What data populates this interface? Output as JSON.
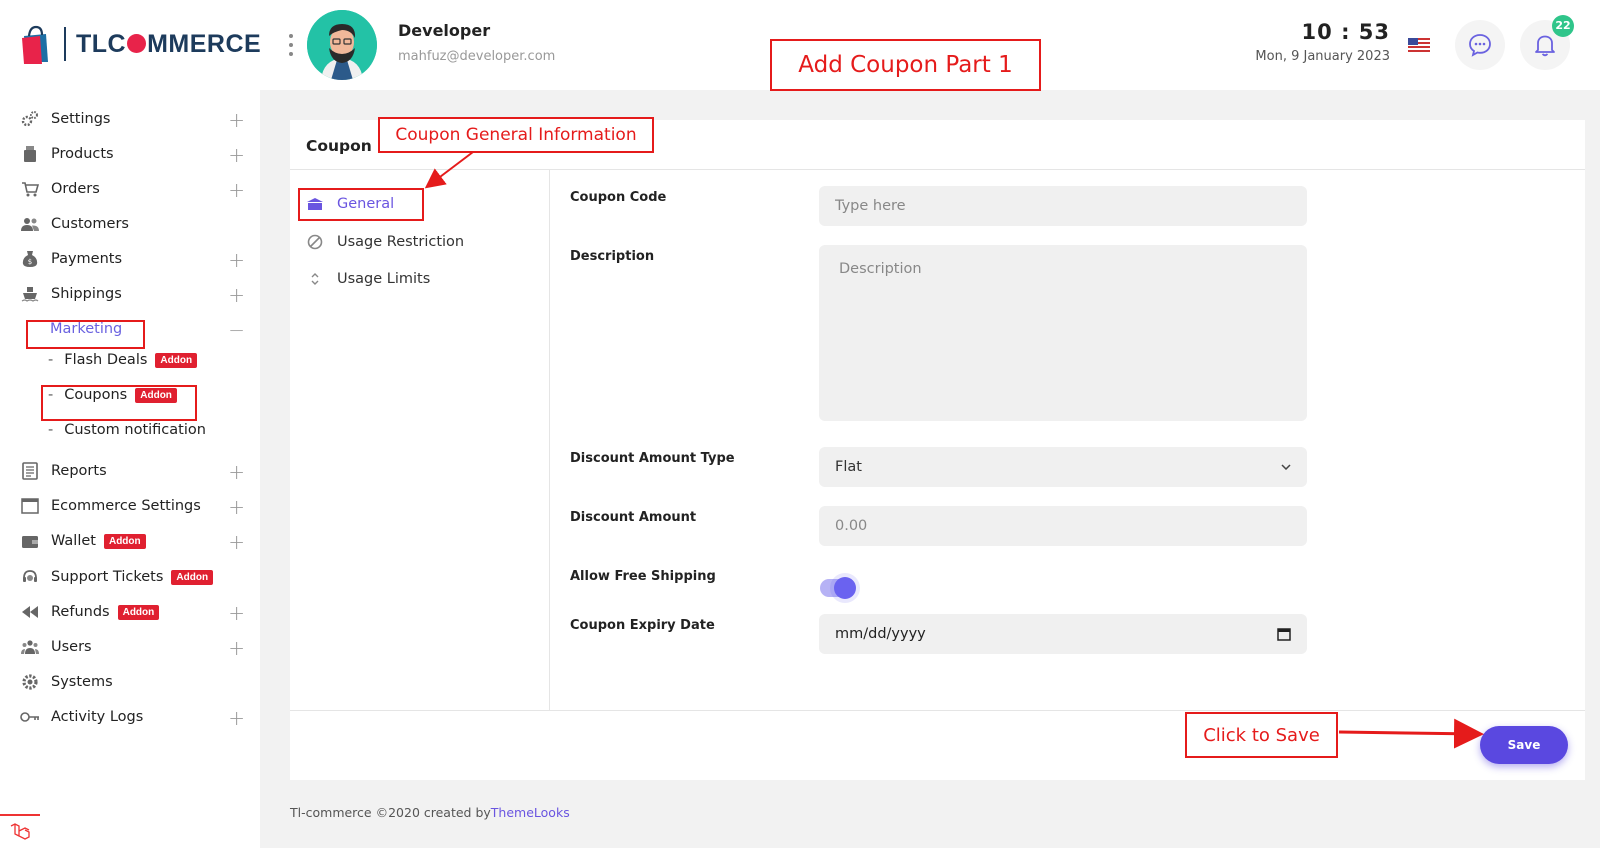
{
  "header": {
    "brand": "TLCOMMERCE",
    "brand_prefix": "TLC",
    "brand_suffix": "MMERCE",
    "user_name": "Developer",
    "user_email": "mahfuz@developer.com",
    "time": "10 : 53",
    "date": "Mon, 9 January 2023",
    "language_flag": "us-flag-icon",
    "notification_count": "22"
  },
  "sidebar": {
    "items": [
      {
        "label": "Settings",
        "icon": "gears-icon",
        "expandable": true
      },
      {
        "label": "Products",
        "icon": "box-icon",
        "expandable": true
      },
      {
        "label": "Orders",
        "icon": "cart-icon",
        "expandable": true
      },
      {
        "label": "Customers",
        "icon": "users-icon",
        "expandable": false
      },
      {
        "label": "Payments",
        "icon": "money-bag-icon",
        "expandable": true
      },
      {
        "label": "Shippings",
        "icon": "ship-icon",
        "expandable": true
      },
      {
        "label": "Marketing",
        "icon": "",
        "expandable": true,
        "expanded": true
      },
      {
        "label": "Reports",
        "icon": "report-icon",
        "expandable": true
      },
      {
        "label": "Ecommerce Settings",
        "icon": "window-icon",
        "expandable": true
      },
      {
        "label": "Wallet",
        "icon": "wallet-icon",
        "expandable": true,
        "badge": "Addon"
      },
      {
        "label": "Support Tickets",
        "icon": "support-icon",
        "expandable": false,
        "badge": "Addon"
      },
      {
        "label": "Refunds",
        "icon": "rewind-icon",
        "expandable": true,
        "badge": "Addon"
      },
      {
        "label": "Users",
        "icon": "users-group-icon",
        "expandable": true
      },
      {
        "label": "Systems",
        "icon": "cog-icon",
        "expandable": false
      },
      {
        "label": "Activity Logs",
        "icon": "key-icon",
        "expandable": true
      }
    ],
    "marketing_sub": [
      {
        "label": "Flash Deals",
        "badge": "Addon"
      },
      {
        "label": "Coupons",
        "badge": "Addon"
      },
      {
        "label": "Custom notification"
      }
    ]
  },
  "card": {
    "title": "Coupon",
    "tabs": [
      "General",
      "Usage Restriction",
      "Usage Limits"
    ],
    "fields": {
      "coupon_code_label": "Coupon Code",
      "coupon_code_placeholder": "Type here",
      "description_label": "Description",
      "description_placeholder": "Description",
      "discount_type_label": "Discount Amount Type",
      "discount_type_value": "Flat",
      "discount_amount_label": "Discount Amount",
      "discount_amount_placeholder": "0.00",
      "free_shipping_label": "Allow Free Shipping",
      "free_shipping_enabled": true,
      "expiry_label": "Coupon Expiry Date",
      "expiry_value": "mm/dd/yyyy"
    },
    "save_label": "Save"
  },
  "footer": {
    "text": "Tl-commerce ©2020 created by",
    "link": "ThemeLooks"
  },
  "annotations": {
    "title": "Add Coupon Part 1",
    "general_info": "Coupon General Information",
    "save_hint": "Click to Save"
  },
  "colors": {
    "accent": "#6a55e0",
    "annotation": "#e51b1b",
    "badge": "#e02030"
  }
}
